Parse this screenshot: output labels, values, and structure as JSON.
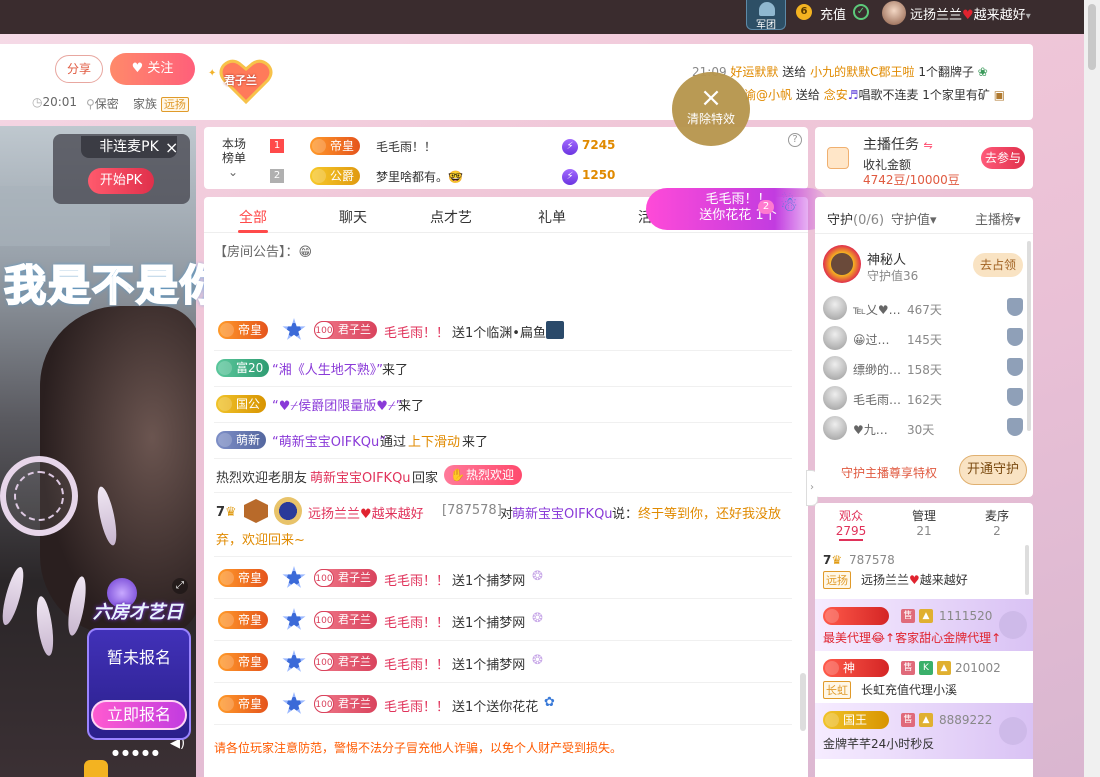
{
  "topbar": {
    "army_label": "军团",
    "coin_symbol": "6",
    "recharge": "充值",
    "username": "远扬兰兰",
    "username_suffix": "越来越好",
    "caret": "▾"
  },
  "header": {
    "share": "分享",
    "follow": "关注",
    "time": "20:01",
    "location": "保密",
    "family_label": "家族",
    "family_tag": "远扬",
    "badge_name": "君子兰",
    "gifts": [
      {
        "time": "21:09",
        "sender": "好运默默",
        "verb": "送给",
        "receiver": "小九的默默C郡王啦",
        "item": "1个翻牌子"
      },
      {
        "time": "",
        "sender": "谕@小帆",
        "verb": "送给",
        "receiver": "念安",
        "item": "唱歌不连麦 1个家里有矿"
      }
    ]
  },
  "effect_button": {
    "close": "×",
    "label": "清除特效"
  },
  "video": {
    "pk_title": "非连麦PK",
    "pk_close": "×",
    "pk_start": "开始PK",
    "lyric": "我是不是你最疼爱的人",
    "promo_caption": "六房才艺日",
    "promo_status": "暂未报名",
    "promo_button": "立即报名"
  },
  "rank": {
    "label_line1": "本场",
    "label_line2": "榜单",
    "chevron": "⌄",
    "help": "?",
    "items": [
      {
        "num": "1",
        "medal": "帝皇",
        "name": "毛毛雨！！",
        "score": "7245"
      },
      {
        "num": "2",
        "medal": "公爵",
        "name": "梦里啥都有。🤓",
        "score": "1250"
      }
    ]
  },
  "floating_gift": {
    "line1": "毛毛雨！！",
    "line2": "送你花花 1个",
    "count": "2"
  },
  "chat": {
    "tabs": [
      "全部",
      "聊天",
      "点才艺",
      "礼单",
      "活"
    ],
    "announcement": "【房间公告】：",
    "rows": [
      {
        "type": "gift",
        "medal": "帝皇",
        "lv": "100",
        "lvname": "君子兰",
        "name": "毛毛雨！！",
        "text": "送1个临渊•扁鱼"
      },
      {
        "type": "enter",
        "medal": "富20",
        "name": "“湘《人生地不熟》”",
        "suffix": "来了"
      },
      {
        "type": "enter",
        "medal": "国公",
        "name": "“♥⌿侯爵团限量版♥⌿”",
        "suffix": "来了"
      },
      {
        "type": "enter",
        "medal": "萌新",
        "name": "“萌新宝宝OIFKQu”",
        "mid": "通过",
        "link": "上下滑动",
        "suffix": "来了"
      },
      {
        "type": "welcome",
        "pre": "热烈欢迎老朋友",
        "name": "萌新宝宝OIFKQu",
        "mid": "回家",
        "btn": "热烈欢迎"
      },
      {
        "type": "say",
        "level": "7",
        "user": "远扬兰兰",
        "user_suffix": "越来越好",
        "id": "[787578]",
        "to_pre": "对",
        "to": "萌新宝宝OIFKQu",
        "say": "说：",
        "msg1": "终于等到你，还好我没放",
        "msg2": "弃，欢迎回来~"
      },
      {
        "type": "gift",
        "medal": "帝皇",
        "lv": "100",
        "lvname": "君子兰",
        "name": "毛毛雨！！",
        "text": "送1个捕梦网"
      },
      {
        "type": "gift",
        "medal": "帝皇",
        "lv": "100",
        "lvname": "君子兰",
        "name": "毛毛雨！！",
        "text": "送1个捕梦网"
      },
      {
        "type": "gift",
        "medal": "帝皇",
        "lv": "100",
        "lvname": "君子兰",
        "name": "毛毛雨！！",
        "text": "送1个捕梦网"
      },
      {
        "type": "gift",
        "medal": "帝皇",
        "lv": "100",
        "lvname": "君子兰",
        "name": "毛毛雨！！",
        "text": "送1个送你花花"
      }
    ],
    "warning": "请各位玩家注意防范，警惕不法分子冒充他人诈骗，以免个人财产受到损失。"
  },
  "task": {
    "title": "主播任务",
    "sub": "收礼金额",
    "progress": "4742豆/10000豆",
    "join": "去参与"
  },
  "guard": {
    "tabs": [
      "守护",
      "(0/6)",
      "守护值▾",
      "主播榜▾"
    ],
    "top": {
      "name": "神秘人",
      "value": "守护值36",
      "btn": "去占领"
    },
    "rows": [
      {
        "name": "℡乂♥…",
        "days": "467天"
      },
      {
        "name": "😀过…",
        "days": "145天"
      },
      {
        "name": "缥缈的…",
        "days": "158天"
      },
      {
        "name": "毛毛雨…",
        "days": "162天"
      },
      {
        "name": "♥九…",
        "days": "30天"
      }
    ],
    "privilege": "守护主播尊享特权",
    "open": "开通守护"
  },
  "audience": {
    "tabs": [
      {
        "label": "观众",
        "count": "2795"
      },
      {
        "label": "管理",
        "count": "21"
      },
      {
        "label": "麦序",
        "count": "2"
      }
    ],
    "rows": [
      {
        "lv": "7",
        "id": "787578",
        "tag": "远扬",
        "name": "远扬兰兰",
        "suffix": "越来越好"
      },
      {
        "medal": "",
        "id": "1111520",
        "name": "最美代理😂↑客家甜心金牌代理↑"
      },
      {
        "medal": "神",
        "id": "201002",
        "tag": "长虹",
        "name": "长虹充值代理小溪"
      },
      {
        "medal": "国王",
        "id": "8889222",
        "name": "金牌芊芊24小时秒反"
      }
    ]
  }
}
